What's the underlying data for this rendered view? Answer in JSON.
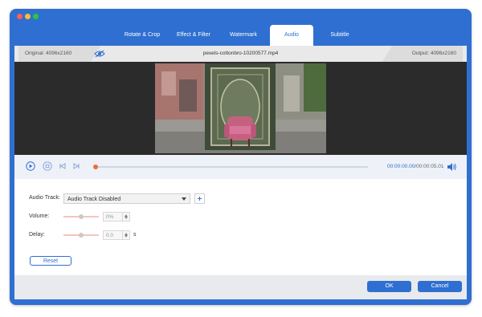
{
  "colors": {
    "accent": "#2f6fd1",
    "progress_knob": "#ef6b3a"
  },
  "tabs": [
    {
      "label": "Rotate & Crop",
      "active": false
    },
    {
      "label": "Effect & Filter",
      "active": false
    },
    {
      "label": "Watermark",
      "active": false
    },
    {
      "label": "Audio",
      "active": true
    },
    {
      "label": "Subtitle",
      "active": false
    }
  ],
  "info": {
    "original": "Original: 4096x2160",
    "filename": "pexels-cottonbro-10200577.mp4",
    "output": "Output: 4096x2160",
    "eye_icon": "eye-icon"
  },
  "player": {
    "current_time": "00:00:00.00",
    "total_time": "/00:00:05.01",
    "progress": 0,
    "icons": [
      "play-icon",
      "stop-icon",
      "skip-back-icon",
      "skip-forward-icon",
      "volume-icon"
    ]
  },
  "audio": {
    "track_label": "Audio Track:",
    "track_value": "Audio Track Disabled",
    "volume_label": "Volume:",
    "volume_value": "0%",
    "delay_label": "Delay:",
    "delay_value": "0.0",
    "delay_unit": "s",
    "reset_label": "Reset"
  },
  "footer": {
    "ok_label": "OK",
    "cancel_label": "Cancel"
  }
}
